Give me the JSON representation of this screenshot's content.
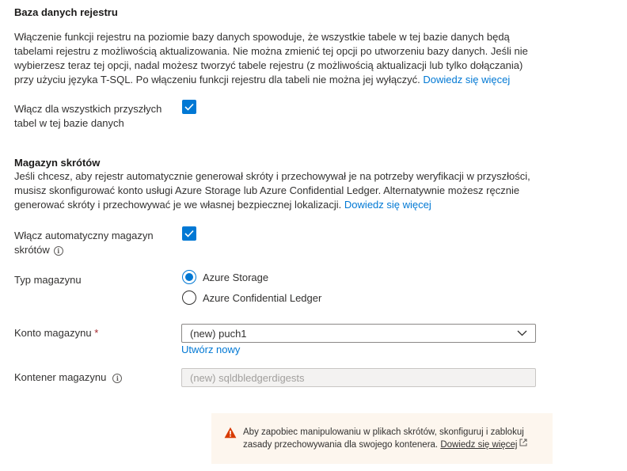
{
  "ledger_db": {
    "heading": "Baza danych rejestru",
    "description_lines": [
      "Włączenie funkcji rejestru na poziomie bazy danych spowoduje, że wszystkie tabele w tej bazie danych będą",
      "tabelami rejestru z możliwością aktualizowania. Nie można zmienić tej opcji po utworzeniu bazy danych. Jeśli nie",
      "wybierzesz teraz tej opcji, nadal możesz tworzyć tabele rejestru (z możliwością aktualizacji lub tylko dołączania)",
      "przy użyciu języka T-SQL. Po włączeniu funkcji rejestru dla tabeli nie można jej wyłączyć."
    ],
    "learn_more": "Dowiedz się więcej",
    "enable_label_lines": [
      "Włącz dla wszystkich przyszłych",
      "tabel w tej bazie danych"
    ],
    "enable_checked": true
  },
  "digest_store": {
    "heading": "Magazyn skrótów",
    "description_lines": [
      "Jeśli chcesz, aby rejestr automatycznie generował skróty i przechowywał je na potrzeby weryfikacji w przyszłości,",
      "musisz skonfigurować konto usługi Azure Storage lub Azure Confidential Ledger. Alternatywnie możesz ręcznie",
      "generować skróty i przechowywać je we własnej bezpiecznej lokalizacji."
    ],
    "learn_more": "Dowiedz się więcej",
    "auto_label_lines": [
      "Włącz automatyczny magazyn",
      "skrótów"
    ],
    "auto_checked": true,
    "storage_type_label": "Typ magazynu",
    "storage_type_options": [
      "Azure Storage",
      "Azure Confidential Ledger"
    ],
    "storage_type_selected": "Azure Storage",
    "account_label": "Konto magazynu",
    "required_mark": "*",
    "account_value": "(new) puch1",
    "create_new": "Utwórz nowy",
    "container_label": "Kontener magazynu",
    "container_value": "(new) sqldbledgerdigests"
  },
  "warning": {
    "line1": "Aby zapobiec manipulowaniu w plikach skrótów, skonfiguruj i zablokuj",
    "line2": "zasady przechowywania dla swojego kontenera.",
    "learn_more": "Dowiedz się więcej"
  },
  "colors": {
    "accent": "#0078d4",
    "warning_icon": "#d83b01",
    "required": "#a4262c"
  }
}
